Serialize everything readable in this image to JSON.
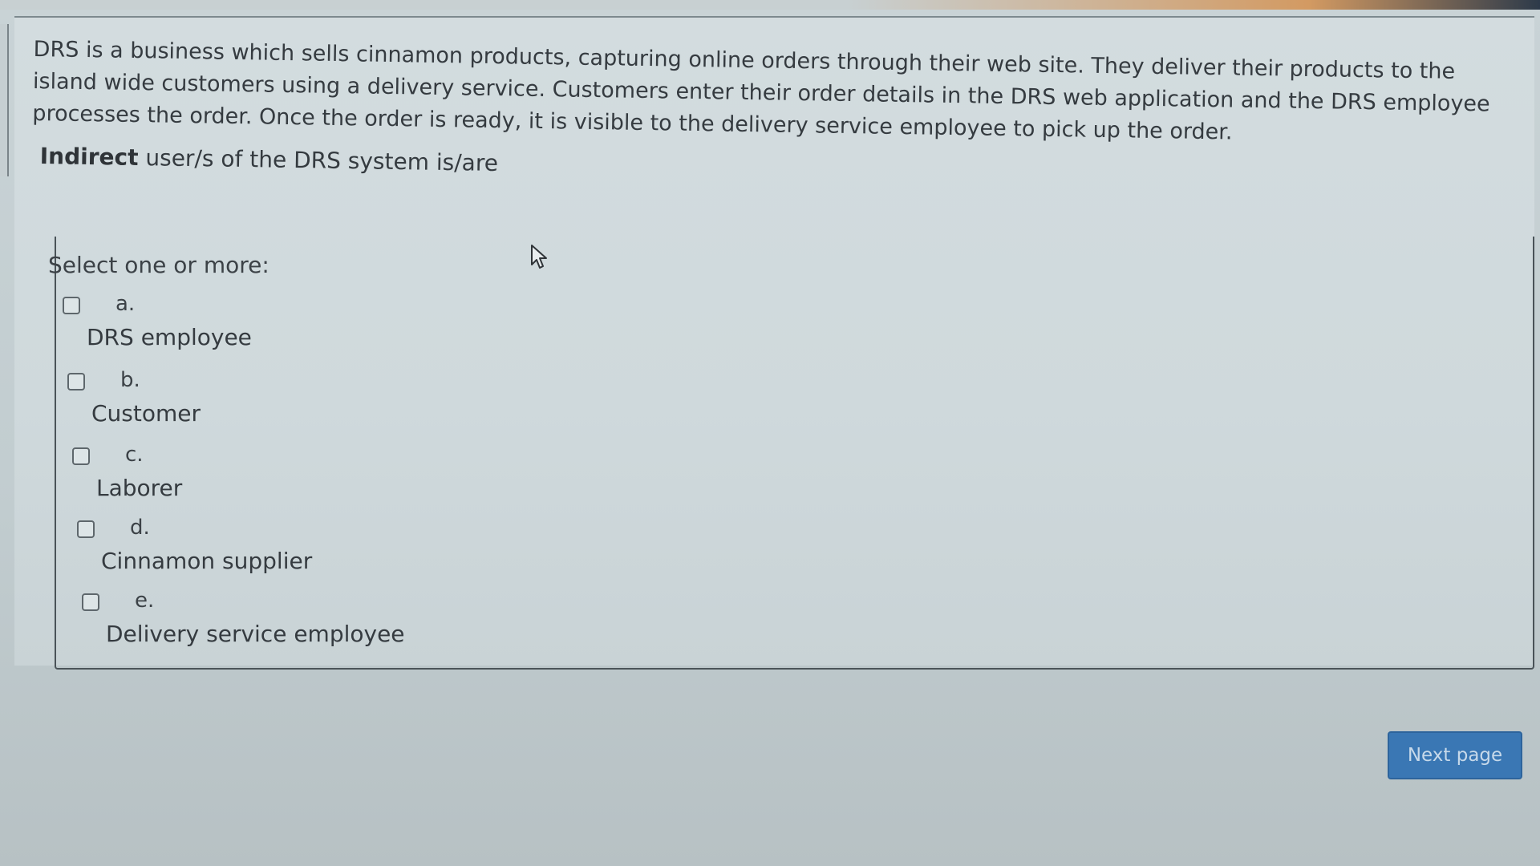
{
  "question": {
    "text": "DRS is a business which sells cinnamon products, capturing online orders through their web site. They deliver their products to the island wide customers using a delivery service. Customers enter their order details in the DRS web application and the DRS employee processes the order. Once the order is ready, it is visible to the delivery service employee to pick up the order.",
    "prompt_bold": "Indirect",
    "prompt_rest": " user/s of the DRS system is/are"
  },
  "answers": {
    "select_label": "Select one or more:",
    "options": [
      {
        "letter": "a.",
        "text": "DRS employee",
        "checked": false
      },
      {
        "letter": "b.",
        "text": "Customer",
        "checked": false
      },
      {
        "letter": "c.",
        "text": "Laborer",
        "checked": false
      },
      {
        "letter": "d.",
        "text": "Cinnamon supplier",
        "checked": false
      },
      {
        "letter": "e.",
        "text": "Delivery service employee",
        "checked": false
      }
    ]
  },
  "navigation": {
    "next_label": "Next page"
  },
  "colors": {
    "accent": "#3a77b4",
    "background": "#c9d3d6"
  },
  "icons": {
    "cursor": "mouse-pointer-icon"
  }
}
